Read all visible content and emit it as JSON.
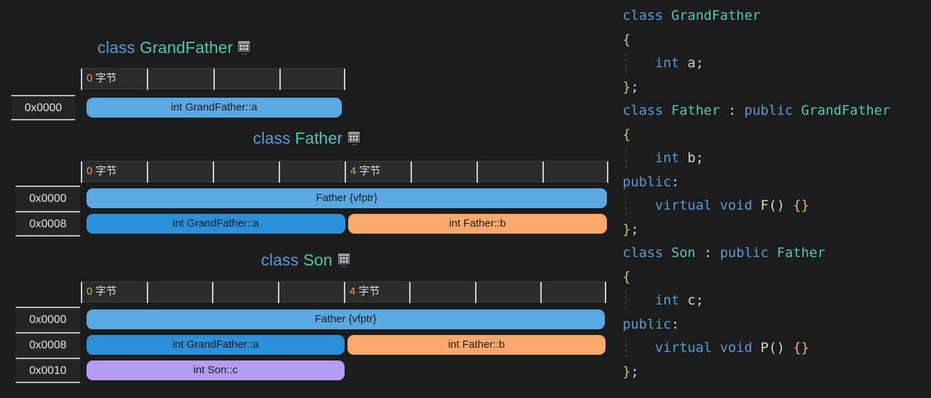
{
  "theme": {
    "background": "#1c1c1c",
    "ruler_bg": "#2b2b2b",
    "addr_bg": "#252525",
    "keyword_blue": "#569cd6",
    "type_green": "#4ec9b0",
    "brace_gold": "#d7ba7d",
    "function_yellow": "#dcdcaa",
    "plain_text": "#d4d4d4"
  },
  "palette": {
    "lightblue": "#5aa9e2",
    "blue": "#2b90d9",
    "orange": "#f8a96b",
    "purple": "#b49cf0"
  },
  "icons": {
    "table_icon": "table-grid-icon",
    "resize_arrow": "↔"
  },
  "ruler_labels": {
    "byte0": "0 字节",
    "byte4": "4 字节",
    "num0": "0",
    "num4": "4",
    "unit": " 字节"
  },
  "diagrams": [
    {
      "id": "grandfather",
      "title_keyword": "class",
      "title_name": "GrandFather",
      "ruler": {
        "labels": [
          "0 字节"
        ],
        "ticks": 4
      },
      "rows": [
        {
          "address": "0x0000",
          "fields": [
            {
              "label": "int GrandFather::a",
              "color": "lightblue"
            }
          ]
        }
      ]
    },
    {
      "id": "father",
      "title_keyword": "class",
      "title_name": "Father",
      "ruler": {
        "labels": [
          "0 字节",
          "4 字节"
        ],
        "ticks": 8
      },
      "rows": [
        {
          "address": "0x0000",
          "fields": [
            {
              "label": "Father {vfptr}",
              "color": "lightblue"
            }
          ]
        },
        {
          "address": "0x0008",
          "fields": [
            {
              "label": "int GrandFather::a",
              "color": "blue"
            },
            {
              "label": "int Father::b",
              "color": "orange"
            }
          ]
        }
      ]
    },
    {
      "id": "son",
      "title_keyword": "class",
      "title_name": "Son",
      "ruler": {
        "labels": [
          "0 字节",
          "4 字节"
        ],
        "ticks": 8
      },
      "rows": [
        {
          "address": "0x0000",
          "fields": [
            {
              "label": "Father {vfptr}",
              "color": "lightblue"
            }
          ]
        },
        {
          "address": "0x0008",
          "fields": [
            {
              "label": "int GrandFather::a",
              "color": "blue"
            },
            {
              "label": "int Father::b",
              "color": "orange"
            }
          ]
        },
        {
          "address": "0x0010",
          "fields": [
            {
              "label": "int Son::c",
              "color": "purple"
            }
          ]
        }
      ]
    }
  ],
  "code": {
    "language": "cpp",
    "lines": [
      {
        "guide": false,
        "tokens": [
          {
            "t": "class",
            "c": "key"
          },
          {
            "t": " ",
            "c": "plain"
          },
          {
            "t": "GrandFather",
            "c": "type"
          }
        ]
      },
      {
        "guide": false,
        "tokens": [
          {
            "t": "{",
            "c": "brace"
          }
        ]
      },
      {
        "guide": true,
        "tokens": [
          {
            "t": "    ",
            "c": "plain"
          },
          {
            "t": "int",
            "c": "key"
          },
          {
            "t": " ",
            "c": "plain"
          },
          {
            "t": "a",
            "c": "plain"
          },
          {
            "t": ";",
            "c": "punct"
          }
        ]
      },
      {
        "guide": false,
        "tokens": [
          {
            "t": "}",
            "c": "brace"
          },
          {
            "t": ";",
            "c": "punct"
          }
        ]
      },
      {
        "guide": false,
        "tokens": [
          {
            "t": "class",
            "c": "key"
          },
          {
            "t": " ",
            "c": "plain"
          },
          {
            "t": "Father",
            "c": "type"
          },
          {
            "t": " ",
            "c": "plain"
          },
          {
            "t": ":",
            "c": "punct"
          },
          {
            "t": " ",
            "c": "plain"
          },
          {
            "t": "public",
            "c": "key"
          },
          {
            "t": " ",
            "c": "plain"
          },
          {
            "t": "GrandFather",
            "c": "type"
          }
        ]
      },
      {
        "guide": false,
        "tokens": [
          {
            "t": "{",
            "c": "brace"
          }
        ]
      },
      {
        "guide": true,
        "tokens": [
          {
            "t": "    ",
            "c": "plain"
          },
          {
            "t": "int",
            "c": "key"
          },
          {
            "t": " ",
            "c": "plain"
          },
          {
            "t": "b",
            "c": "plain"
          },
          {
            "t": ";",
            "c": "punct"
          }
        ]
      },
      {
        "guide": false,
        "tokens": [
          {
            "t": "public",
            "c": "key"
          },
          {
            "t": ":",
            "c": "punct"
          }
        ]
      },
      {
        "guide": true,
        "tokens": [
          {
            "t": "    ",
            "c": "plain"
          },
          {
            "t": "virtual",
            "c": "key"
          },
          {
            "t": " ",
            "c": "plain"
          },
          {
            "t": "void",
            "c": "key"
          },
          {
            "t": " ",
            "c": "plain"
          },
          {
            "t": "F",
            "c": "func"
          },
          {
            "t": "()",
            "c": "punct"
          },
          {
            "t": " ",
            "c": "plain"
          },
          {
            "t": "{}",
            "c": "brace"
          }
        ]
      },
      {
        "guide": false,
        "tokens": [
          {
            "t": "}",
            "c": "brace"
          },
          {
            "t": ";",
            "c": "punct"
          }
        ]
      },
      {
        "guide": false,
        "tokens": [
          {
            "t": "class",
            "c": "key"
          },
          {
            "t": " ",
            "c": "plain"
          },
          {
            "t": "Son",
            "c": "type"
          },
          {
            "t": " ",
            "c": "plain"
          },
          {
            "t": ":",
            "c": "punct"
          },
          {
            "t": " ",
            "c": "plain"
          },
          {
            "t": "public",
            "c": "key"
          },
          {
            "t": " ",
            "c": "plain"
          },
          {
            "t": "Father",
            "c": "type"
          }
        ]
      },
      {
        "guide": false,
        "tokens": [
          {
            "t": "{",
            "c": "brace"
          }
        ]
      },
      {
        "guide": true,
        "tokens": [
          {
            "t": "    ",
            "c": "plain"
          },
          {
            "t": "int",
            "c": "key"
          },
          {
            "t": " ",
            "c": "plain"
          },
          {
            "t": "c",
            "c": "plain"
          },
          {
            "t": ";",
            "c": "punct"
          }
        ]
      },
      {
        "guide": false,
        "tokens": [
          {
            "t": "public",
            "c": "key"
          },
          {
            "t": ":",
            "c": "punct"
          }
        ]
      },
      {
        "guide": true,
        "tokens": [
          {
            "t": "    ",
            "c": "plain"
          },
          {
            "t": "virtual",
            "c": "key"
          },
          {
            "t": " ",
            "c": "plain"
          },
          {
            "t": "void",
            "c": "key"
          },
          {
            "t": " ",
            "c": "plain"
          },
          {
            "t": "P",
            "c": "func"
          },
          {
            "t": "()",
            "c": "punct"
          },
          {
            "t": " ",
            "c": "plain"
          },
          {
            "t": "{}",
            "c": "brace"
          }
        ]
      },
      {
        "guide": false,
        "tokens": [
          {
            "t": "}",
            "c": "brace"
          },
          {
            "t": ";",
            "c": "punct"
          }
        ]
      }
    ]
  }
}
